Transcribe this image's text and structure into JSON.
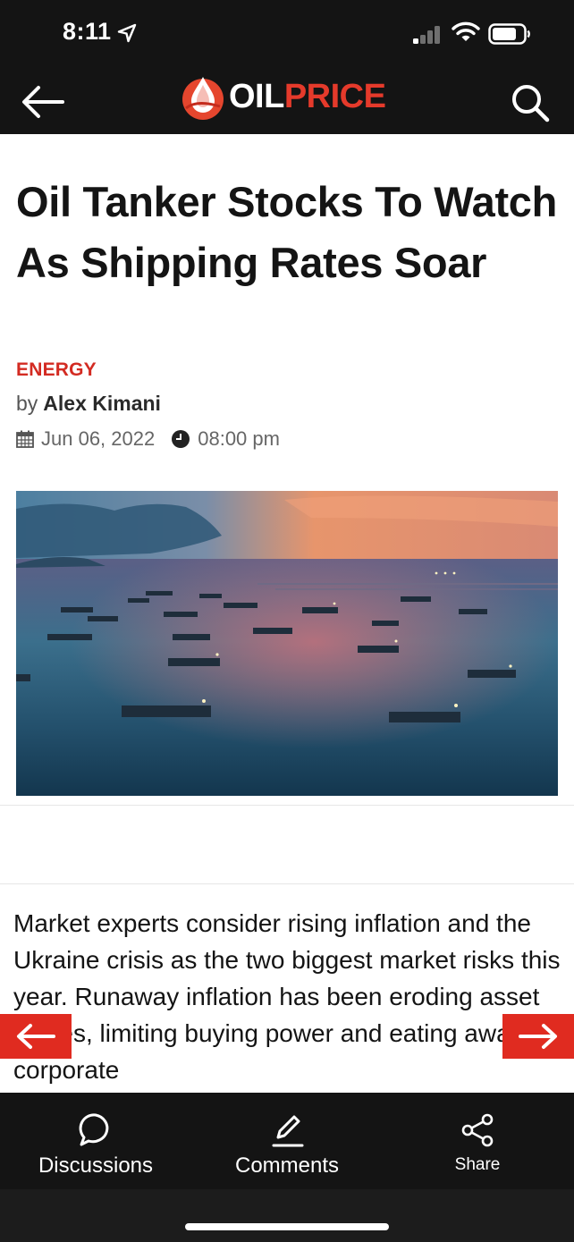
{
  "status_bar": {
    "time": "8:11"
  },
  "header": {
    "logo_oil": "OIL",
    "logo_price": "PRICE",
    "back_icon": "arrow-left-icon",
    "search_icon": "search-icon"
  },
  "article": {
    "title": "Oil Tanker Stocks To Watch As Shipping Rates Soar",
    "category": "ENERGY",
    "by_label": "by",
    "author": "Alex Kimani",
    "date": "Jun 06, 2022",
    "time": "08:00 pm",
    "body": "Market experts consider rising inflation and the Ukraine crisis as the two biggest market risks this year. Runaway inflation has been eroding asset values, limiting buying power and eating away at corporate"
  },
  "tabs": [
    {
      "label": "Discussions",
      "icon": "speech-bubble-icon"
    },
    {
      "label": "Comments",
      "icon": "pencil-icon"
    },
    {
      "label": "Share",
      "icon": "share-icon"
    }
  ],
  "colors": {
    "accent": "#e02b20",
    "dark": "#141414"
  }
}
